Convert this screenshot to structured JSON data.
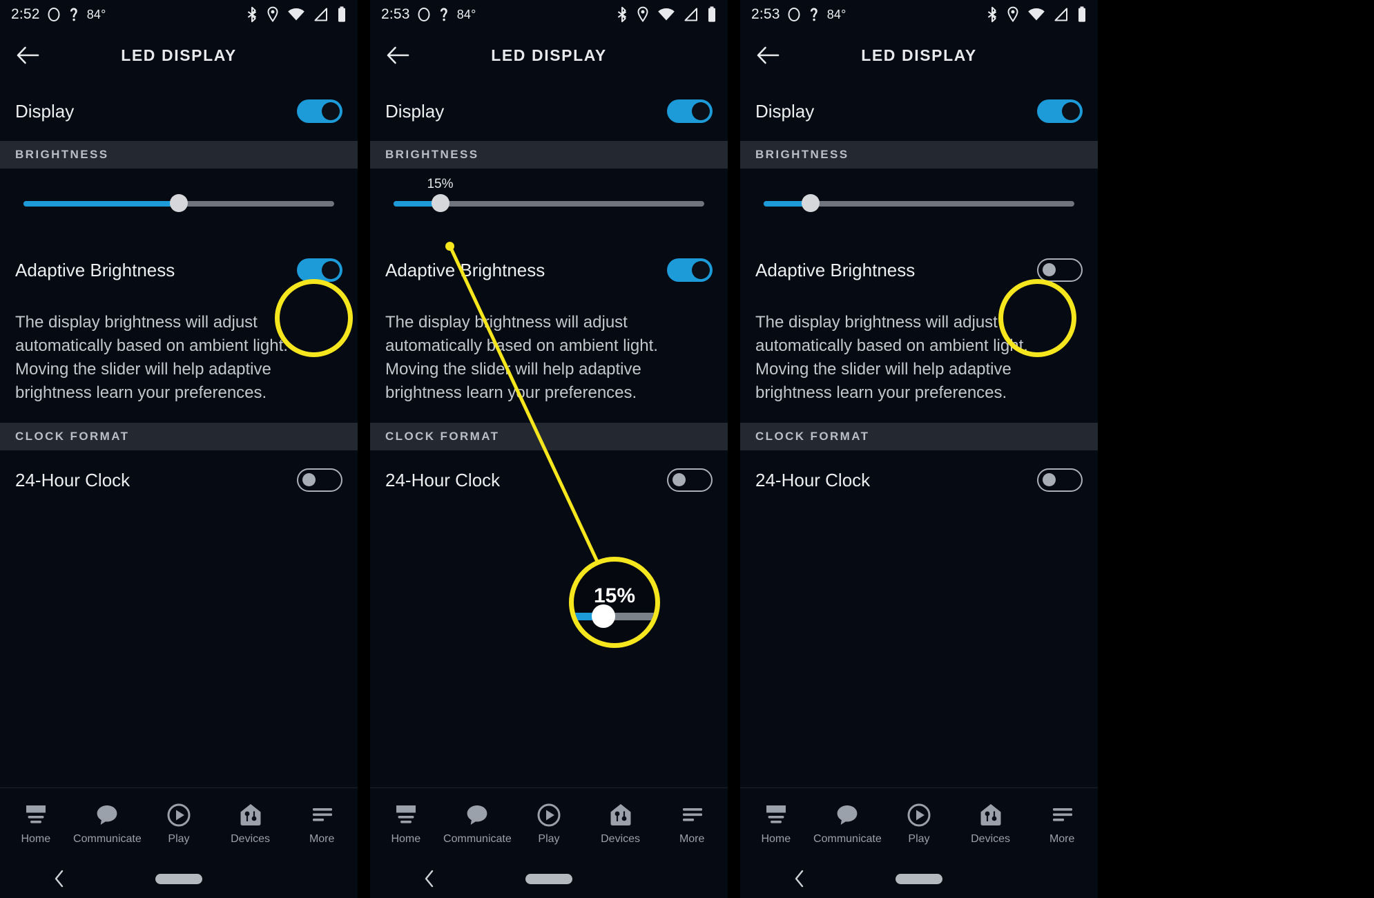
{
  "meta": {
    "accent_blue": "#1d9bd8",
    "annotation_yellow": "#f5e61e",
    "background": "#060a12",
    "section_header_bg": "#232831"
  },
  "panels": [
    {
      "id": "panel-1",
      "status_bar": {
        "time": "2:52",
        "temperature": "84°",
        "icons": [
          "circle-icon",
          "alexa-icon",
          "bluetooth-icon",
          "location-icon",
          "wifi-icon",
          "signal-icon",
          "battery-icon"
        ]
      },
      "app_bar": {
        "back": "back-arrow-icon",
        "title": "LED DISPLAY"
      },
      "display_row": {
        "label": "Display",
        "toggle_state": "on"
      },
      "brightness_header": "BRIGHTNESS",
      "slider": {
        "percent": 50,
        "value_label": "",
        "show_value": false
      },
      "adaptive_row": {
        "label": "Adaptive Brightness",
        "toggle_state": "on"
      },
      "description": "The display brightness will adjust automatically based on ambient light. Moving the slider will help adaptive brightness learn your preferences.",
      "clock_header": "CLOCK FORMAT",
      "clock_row": {
        "label": "24-Hour Clock",
        "toggle_state": "off"
      },
      "nav": [
        {
          "label": "Home",
          "icon": "home-icon"
        },
        {
          "label": "Communicate",
          "icon": "chat-bubble-icon"
        },
        {
          "label": "Play",
          "icon": "play-circle-icon"
        },
        {
          "label": "Devices",
          "icon": "devices-house-icon"
        },
        {
          "label": "More",
          "icon": "more-lines-icon"
        }
      ],
      "sysnav": {
        "back": "chevron-left-icon",
        "home": "home-pill-indicator"
      },
      "annotation": {
        "type": "circle",
        "target": "adaptive-brightness-toggle"
      }
    },
    {
      "id": "panel-2",
      "status_bar": {
        "time": "2:53",
        "temperature": "84°",
        "icons": [
          "circle-icon",
          "alexa-icon",
          "bluetooth-icon",
          "location-icon",
          "wifi-icon",
          "signal-icon",
          "battery-icon"
        ]
      },
      "app_bar": {
        "back": "back-arrow-icon",
        "title": "LED DISPLAY"
      },
      "display_row": {
        "label": "Display",
        "toggle_state": "on"
      },
      "brightness_header": "BRIGHTNESS",
      "slider": {
        "percent": 15,
        "value_label": "15%",
        "show_value": true
      },
      "adaptive_row": {
        "label": "Adaptive Brightness",
        "toggle_state": "on"
      },
      "description": "The display brightness will adjust automatically based on ambient light. Moving the slider will help adaptive brightness learn your preferences.",
      "clock_header": "CLOCK FORMAT",
      "clock_row": {
        "label": "24-Hour Clock",
        "toggle_state": "off"
      },
      "nav": [
        {
          "label": "Home",
          "icon": "home-icon"
        },
        {
          "label": "Communicate",
          "icon": "chat-bubble-icon"
        },
        {
          "label": "Play",
          "icon": "play-circle-icon"
        },
        {
          "label": "Devices",
          "icon": "devices-house-icon"
        },
        {
          "label": "More",
          "icon": "more-lines-icon"
        }
      ],
      "sysnav": {
        "back": "chevron-left-icon",
        "home": "home-pill-indicator"
      },
      "annotation": {
        "type": "magnifier-callout",
        "target": "brightness-slider-thumb",
        "callout_value": "15%"
      }
    },
    {
      "id": "panel-3",
      "status_bar": {
        "time": "2:53",
        "temperature": "84°",
        "icons": [
          "circle-icon",
          "alexa-icon",
          "bluetooth-icon",
          "location-icon",
          "wifi-icon",
          "signal-icon",
          "battery-icon"
        ]
      },
      "app_bar": {
        "back": "back-arrow-icon",
        "title": "LED DISPLAY"
      },
      "display_row": {
        "label": "Display",
        "toggle_state": "on"
      },
      "brightness_header": "BRIGHTNESS",
      "slider": {
        "percent": 15,
        "value_label": "",
        "show_value": false
      },
      "adaptive_row": {
        "label": "Adaptive Brightness",
        "toggle_state": "off"
      },
      "description": "The display brightness will adjust automatically based on ambient light. Moving the slider will help adaptive brightness learn your preferences.",
      "clock_header": "CLOCK FORMAT",
      "clock_row": {
        "label": "24-Hour Clock",
        "toggle_state": "off"
      },
      "nav": [
        {
          "label": "Home",
          "icon": "home-icon"
        },
        {
          "label": "Communicate",
          "icon": "chat-bubble-icon"
        },
        {
          "label": "Play",
          "icon": "play-circle-icon"
        },
        {
          "label": "Devices",
          "icon": "devices-house-icon"
        },
        {
          "label": "More",
          "icon": "more-lines-icon"
        }
      ],
      "sysnav": {
        "back": "chevron-left-icon",
        "home": "home-pill-indicator"
      },
      "annotation": {
        "type": "circle",
        "target": "adaptive-brightness-toggle"
      }
    }
  ]
}
